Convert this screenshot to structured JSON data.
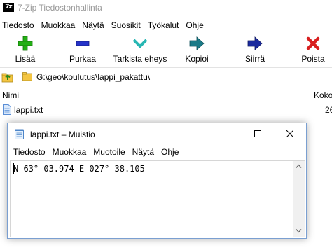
{
  "zip": {
    "icon_text": "7z",
    "title": "7-Zip Tiedostonhallinta",
    "menu": [
      "Tiedosto",
      "Muokkaa",
      "Näytä",
      "Suosikit",
      "Työkalut",
      "Ohje"
    ],
    "toolbar": {
      "add": "Lisää",
      "extract": "Purkaa",
      "test": "Tarkista eheys",
      "copy": "Kopioi",
      "move": "Siirrä",
      "delete": "Poista"
    },
    "path": "G:\\geo\\koulutus\\lappi_pakattu\\",
    "columns": {
      "name": "Nimi",
      "size": "Koko"
    },
    "files": [
      {
        "name": "lappi.txt",
        "size": "26"
      }
    ],
    "colors": {
      "add": "#23b014",
      "extract": "#2533c9",
      "test": "#27b7b3",
      "copy": "#1a7a87",
      "move": "#1a2a9e",
      "delete": "#d82020"
    }
  },
  "notepad": {
    "title": "lappi.txt – Muistio",
    "menu": [
      "Tiedosto",
      "Muokkaa",
      "Muotoile",
      "Näytä",
      "Ohje"
    ],
    "content": "N 63° 03.974 E 027° 38.105"
  }
}
